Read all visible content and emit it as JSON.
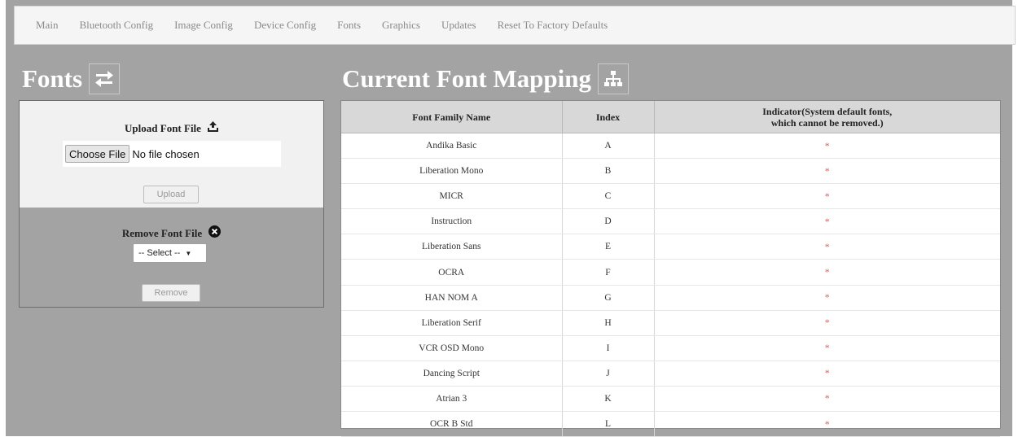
{
  "nav": {
    "items": [
      "Main",
      "Bluetooth Config",
      "Image Config",
      "Device Config",
      "Fonts",
      "Graphics",
      "Updates",
      "Reset To Factory Defaults"
    ]
  },
  "fonts_heading": "Fonts",
  "mapping_heading": "Current Font Mapping",
  "upload": {
    "title": "Upload Font File",
    "choose_label": "Choose File",
    "no_file_text": "No file chosen",
    "upload_button": "Upload"
  },
  "remove": {
    "title": "Remove Font File",
    "select_value": "-- Select --",
    "remove_button": "Remove"
  },
  "table": {
    "headers": {
      "family": "Font Family Name",
      "index": "Index",
      "indicator_line1": "Indicator(System default fonts,",
      "indicator_line2": "which cannot be removed.)"
    },
    "rows": [
      {
        "family": "Andika Basic",
        "index": "A",
        "indicator": "*"
      },
      {
        "family": "Liberation Mono",
        "index": "B",
        "indicator": "*"
      },
      {
        "family": "MICR",
        "index": "C",
        "indicator": "*"
      },
      {
        "family": "Instruction",
        "index": "D",
        "indicator": "*"
      },
      {
        "family": "Liberation Sans",
        "index": "E",
        "indicator": "*"
      },
      {
        "family": "OCRA",
        "index": "F",
        "indicator": "*"
      },
      {
        "family": "HAN NOM A",
        "index": "G",
        "indicator": "*"
      },
      {
        "family": "Liberation Serif",
        "index": "H",
        "indicator": "*"
      },
      {
        "family": "VCR OSD Mono",
        "index": "I",
        "indicator": "*"
      },
      {
        "family": "Dancing Script",
        "index": "J",
        "indicator": "*"
      },
      {
        "family": "Atrian 3",
        "index": "K",
        "indicator": "*"
      },
      {
        "family": "OCR B Std",
        "index": "L",
        "indicator": "*"
      }
    ]
  },
  "colors": {
    "page_bg": "#a3a3a3",
    "header_bg": "#d8d8d8",
    "indicator": "#e25b5b"
  },
  "icons": {
    "fonts": "swap-arrows-icon",
    "mapping": "sitemap-icon",
    "upload": "upload-icon",
    "remove": "remove-circle-icon"
  }
}
